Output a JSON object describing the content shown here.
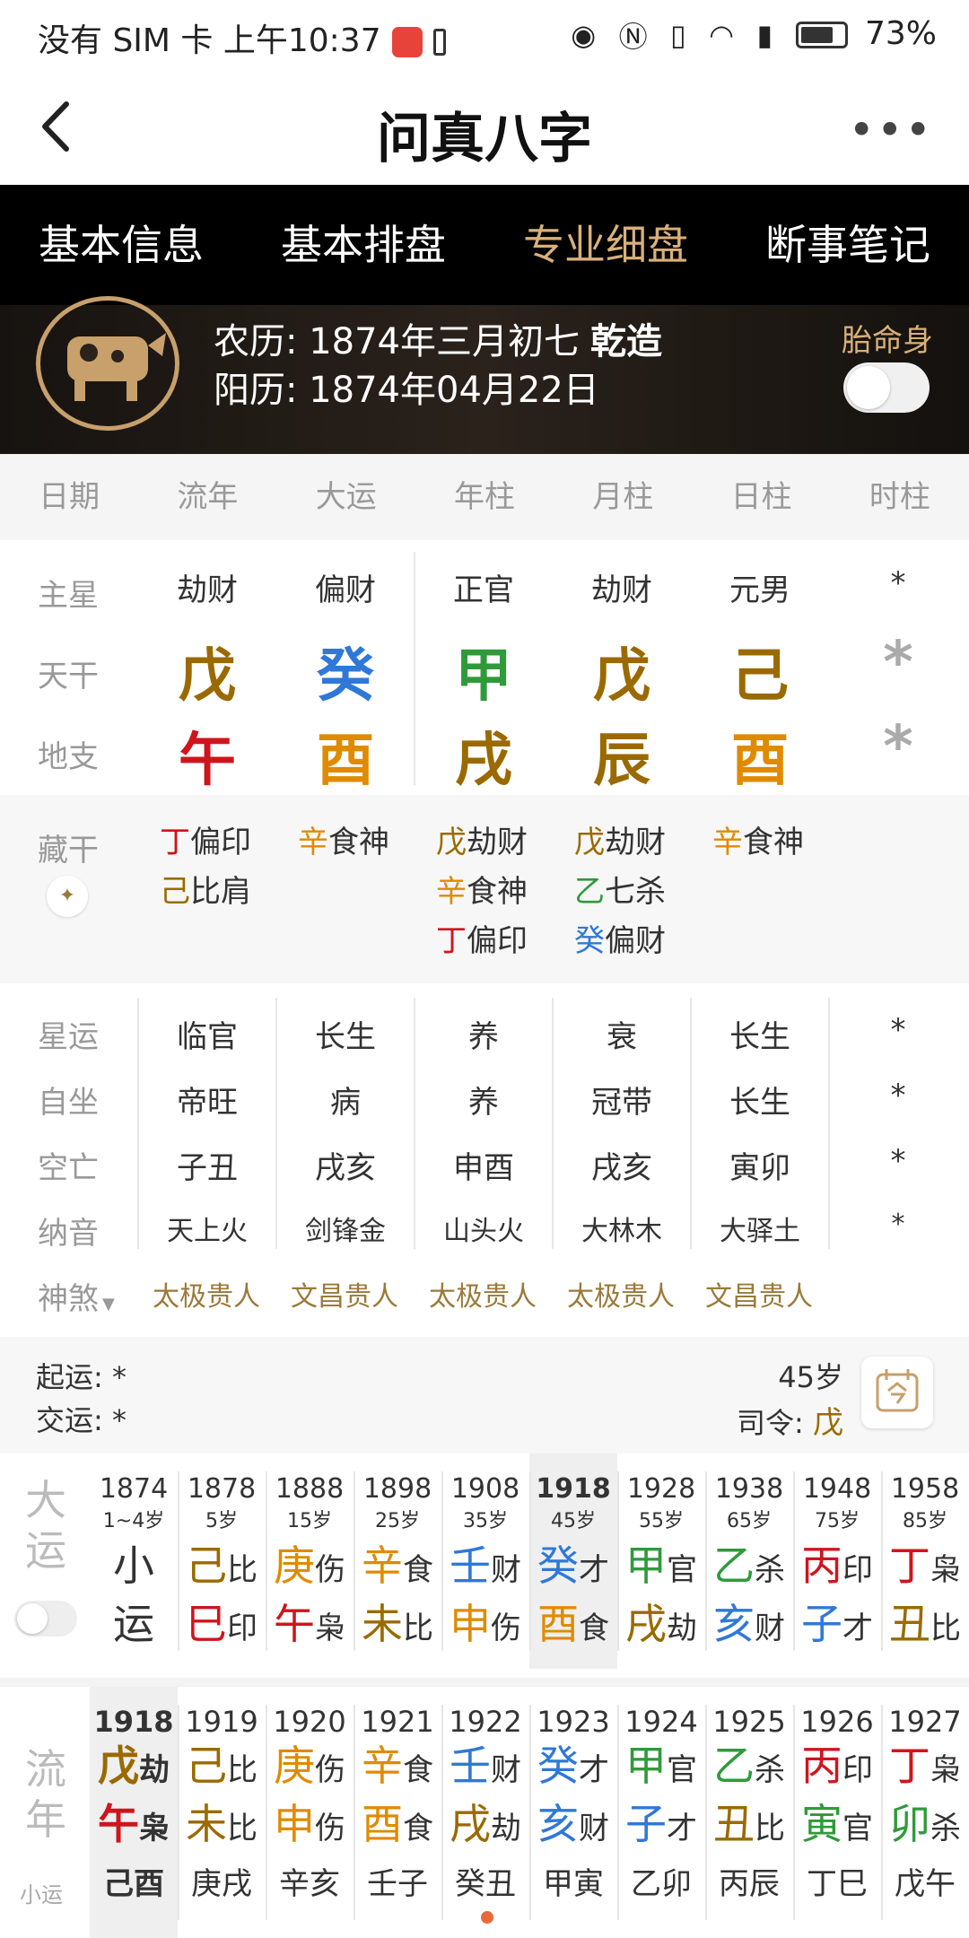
{
  "status": {
    "left": "没有 SIM 卡 上午10:37",
    "battery": "73%"
  },
  "title": "问真八字",
  "tabs": [
    "基本信息",
    "基本排盘",
    "专业细盘",
    "断事笔记"
  ],
  "header": {
    "lunar_label": "农历:",
    "lunar": "1874年三月初七",
    "gender": "乾造",
    "solar_label": "阳历:",
    "solar": "1874年04月22日",
    "taiming_label": "胎命身"
  },
  "columns": [
    "日期",
    "流年",
    "大运",
    "年柱",
    "月柱",
    "日柱",
    "时柱"
  ],
  "rows": {
    "zhuxing": {
      "label": "主星",
      "values": [
        "劫财",
        "偏财",
        "正官",
        "劫财",
        "元男",
        "*"
      ]
    },
    "tiangan": {
      "label": "天干",
      "values": [
        "戊",
        "癸",
        "甲",
        "戊",
        "己",
        "*"
      ]
    },
    "dizhi": {
      "label": "地支",
      "values": [
        "午",
        "酉",
        "戌",
        "辰",
        "酉",
        "*"
      ]
    },
    "canggan_label": "藏干",
    "canggan": [
      [
        {
          "g": "丁",
          "s": "偏印"
        },
        {
          "g": "己",
          "s": "比肩"
        }
      ],
      [
        {
          "g": "辛",
          "s": "食神"
        }
      ],
      [
        {
          "g": "戊",
          "s": "劫财"
        },
        {
          "g": "辛",
          "s": "食神"
        },
        {
          "g": "丁",
          "s": "偏印"
        }
      ],
      [
        {
          "g": "戊",
          "s": "劫财"
        },
        {
          "g": "乙",
          "s": "七杀"
        },
        {
          "g": "癸",
          "s": "偏财"
        }
      ],
      [
        {
          "g": "辛",
          "s": "食神"
        }
      ]
    ],
    "xingyun": {
      "label": "星运",
      "values": [
        "临官",
        "长生",
        "养",
        "衰",
        "长生",
        "*"
      ]
    },
    "zizuo": {
      "label": "自坐",
      "values": [
        "帝旺",
        "病",
        "养",
        "冠带",
        "长生",
        "*"
      ]
    },
    "kongwang": {
      "label": "空亡",
      "values": [
        "子丑",
        "戌亥",
        "申酉",
        "戌亥",
        "寅卯",
        "*"
      ]
    },
    "nayin": {
      "label": "纳音",
      "values": [
        "天上火",
        "剑锋金",
        "山头火",
        "大林木",
        "大驿土",
        "*"
      ]
    },
    "shensha": {
      "label": "神煞",
      "values": [
        "太极贵人",
        "文昌贵人",
        "太极贵人",
        "太极贵人",
        "文昌贵人"
      ]
    }
  },
  "yun": {
    "qiyun_label": "起运:",
    "qiyun": "*",
    "jiaoyun_label": "交运:",
    "jiaoyun": "*",
    "age": "45岁",
    "siling_label": "司令:",
    "siling": "戊"
  },
  "dayun": {
    "label": [
      "大",
      "运"
    ],
    "items": [
      {
        "year": "1874",
        "age": "1~4岁",
        "g": "小",
        "gs": "",
        "z": "运",
        "zs": ""
      },
      {
        "year": "1878",
        "age": "5岁",
        "g": "己",
        "gs": "比",
        "z": "巳",
        "zs": "印"
      },
      {
        "year": "1888",
        "age": "15岁",
        "g": "庚",
        "gs": "伤",
        "z": "午",
        "zs": "枭"
      },
      {
        "year": "1898",
        "age": "25岁",
        "g": "辛",
        "gs": "食",
        "z": "未",
        "zs": "比"
      },
      {
        "year": "1908",
        "age": "35岁",
        "g": "壬",
        "gs": "财",
        "z": "申",
        "zs": "伤"
      },
      {
        "year": "1918",
        "age": "45岁",
        "g": "癸",
        "gs": "才",
        "z": "酉",
        "zs": "食"
      },
      {
        "year": "1928",
        "age": "55岁",
        "g": "甲",
        "gs": "官",
        "z": "戌",
        "zs": "劫"
      },
      {
        "year": "1938",
        "age": "65岁",
        "g": "乙",
        "gs": "杀",
        "z": "亥",
        "zs": "财"
      },
      {
        "year": "1948",
        "age": "75岁",
        "g": "丙",
        "gs": "印",
        "z": "子",
        "zs": "才"
      },
      {
        "year": "1958",
        "age": "85岁",
        "g": "丁",
        "gs": "枭",
        "z": "丑",
        "zs": "比"
      }
    ]
  },
  "liunian": {
    "label": [
      "流",
      "年"
    ],
    "sub": "小运",
    "items": [
      {
        "year": "1918",
        "g": "戊",
        "gs": "劫",
        "z": "午",
        "zs": "枭",
        "xy": "己酉"
      },
      {
        "year": "1919",
        "g": "己",
        "gs": "比",
        "z": "未",
        "zs": "比",
        "xy": "庚戌"
      },
      {
        "year": "1920",
        "g": "庚",
        "gs": "伤",
        "z": "申",
        "zs": "伤",
        "xy": "辛亥"
      },
      {
        "year": "1921",
        "g": "辛",
        "gs": "食",
        "z": "酉",
        "zs": "食",
        "xy": "壬子"
      },
      {
        "year": "1922",
        "g": "壬",
        "gs": "财",
        "z": "戌",
        "zs": "劫",
        "xy": "癸丑"
      },
      {
        "year": "1923",
        "g": "癸",
        "gs": "才",
        "z": "亥",
        "zs": "财",
        "xy": "甲寅"
      },
      {
        "year": "1924",
        "g": "甲",
        "gs": "官",
        "z": "子",
        "zs": "才",
        "xy": "乙卯"
      },
      {
        "year": "1925",
        "g": "乙",
        "gs": "杀",
        "z": "丑",
        "zs": "比",
        "xy": "丙辰"
      },
      {
        "year": "1926",
        "g": "丙",
        "gs": "印",
        "z": "寅",
        "zs": "官",
        "xy": "丁巳"
      },
      {
        "year": "1927",
        "g": "丁",
        "gs": "枭",
        "z": "卯",
        "zs": "杀",
        "xy": "戊午"
      }
    ]
  },
  "colors": {
    "accent": "#d9b07a",
    "earth": "#9a6a00",
    "wood": "#2f9a3a",
    "water": "#2f78d8",
    "fire": "#d0141d",
    "metal": "#e08a00"
  }
}
